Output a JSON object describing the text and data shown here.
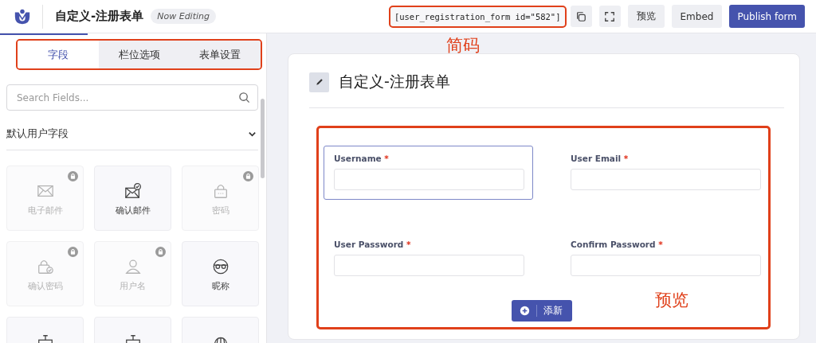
{
  "header": {
    "title": "自定义-注册表单",
    "badge": "Now Editing",
    "shortcode": "[user_registration_form id=\"582\"]",
    "buttons": [
      {
        "kind": "copy"
      },
      {
        "kind": "fullscreen"
      },
      {
        "kind": "text",
        "label": "预览"
      },
      {
        "kind": "text",
        "label": "Embed"
      },
      {
        "kind": "primary",
        "label": "Publish form"
      }
    ]
  },
  "sidebar": {
    "tabs": [
      {
        "label": "字段",
        "selected": true
      },
      {
        "label": "栏位选项",
        "selected": false
      },
      {
        "label": "表单设置",
        "selected": false
      }
    ],
    "search": {
      "placeholder": "Search Fields..."
    },
    "section": {
      "title": "默认用户字段",
      "expanded": true
    },
    "fields": [
      {
        "kind": "envelope",
        "label": "电子邮件",
        "locked": true
      },
      {
        "kind": "envelope-check",
        "label": "确认邮件",
        "locked": false
      },
      {
        "kind": "padlock",
        "label": "密码",
        "locked": true
      },
      {
        "kind": "padlock-check",
        "label": "确认密码",
        "locked": true
      },
      {
        "kind": "person",
        "label": "用户名",
        "locked": true
      },
      {
        "kind": "mask",
        "label": "昵称",
        "locked": false
      },
      {
        "kind": "frame",
        "locked": false
      },
      {
        "kind": "frame",
        "locked": false
      },
      {
        "kind": "globe",
        "locked": false
      }
    ]
  },
  "form": {
    "title": "自定义-注册表单",
    "fields": [
      {
        "label": "Username",
        "required_mark": "*",
        "selected": true
      },
      {
        "label": "User Email",
        "required_mark": "*",
        "selected": false
      },
      {
        "label": "User Password",
        "required_mark": "*",
        "selected": false
      },
      {
        "label": "Confirm Password",
        "required_mark": "*",
        "selected": false
      }
    ],
    "add_button": "添新"
  },
  "annotations": [
    {
      "label": "简码"
    },
    {
      "label": "预览"
    }
  ]
}
